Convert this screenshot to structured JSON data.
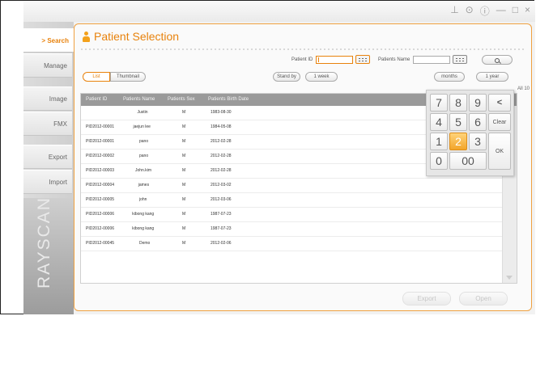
{
  "window_controls": [
    {
      "name": "pin-icon",
      "glyph": "⊥"
    },
    {
      "name": "settings-icon",
      "glyph": "⊙"
    },
    {
      "name": "help-icon",
      "glyph": "ⓘ"
    },
    {
      "name": "minimize-icon",
      "glyph": "—"
    },
    {
      "name": "maximize-icon",
      "glyph": "□"
    },
    {
      "name": "close-icon",
      "glyph": "×"
    }
  ],
  "sidebar": {
    "items": [
      {
        "label": "> Search",
        "active": true
      },
      {
        "label": "Manage"
      },
      {
        "label": "Image"
      },
      {
        "label": "FMX"
      },
      {
        "label": "Export"
      },
      {
        "label": "Import"
      }
    ],
    "brand": "RAYSCAN"
  },
  "page": {
    "title": "Patient Selection",
    "accent": "#e8820c"
  },
  "search": {
    "patient_id_label": "Patient ID",
    "patient_id_value": "",
    "patient_name_label": "Patients Name",
    "patient_name_value": "",
    "search_button_icon": "search-icon"
  },
  "view_tabs": [
    "List",
    "Thumbnail"
  ],
  "view_tab_selected": "List",
  "date_filters": [
    "Stand by",
    "1 week",
    "months",
    "1 year"
  ],
  "record_count": "All 10",
  "table": {
    "columns": [
      "Patient ID",
      "Patients Name",
      "Patients Sex",
      "Patients Birth Date"
    ],
    "rows": [
      [
        "",
        "Justin",
        "M",
        "1983-08-30"
      ],
      [
        "PID2012-00001",
        "jaejun lee",
        "M",
        "1984-05-08"
      ],
      [
        "PID2012-00001",
        "pano",
        "M",
        "2012-02-28"
      ],
      [
        "PID2012-00002",
        "pano",
        "M",
        "2012-02-28"
      ],
      [
        "PID2012-00003",
        "John.kim",
        "M",
        "2012-02-28"
      ],
      [
        "PID2012-00004",
        "james",
        "M",
        "2012-03-02"
      ],
      [
        "PID2012-00005",
        "john",
        "M",
        "2012-03-06"
      ],
      [
        "PID2012-00006",
        "kibong kang",
        "M",
        "1987-07-23"
      ],
      [
        "PID2012-00006",
        "kibong kang",
        "M",
        "1987-07-23"
      ],
      [
        "PID2012-00045",
        "Demo",
        "M",
        "2012-02-06"
      ]
    ]
  },
  "footer": {
    "export_label": "Export",
    "open_label": "Open"
  },
  "numpad": {
    "keys": [
      "7",
      "8",
      "9",
      "<",
      "4",
      "5",
      "6",
      "Clear",
      "1",
      "2",
      "3",
      "OK",
      "0",
      "00"
    ],
    "highlighted": "2"
  }
}
